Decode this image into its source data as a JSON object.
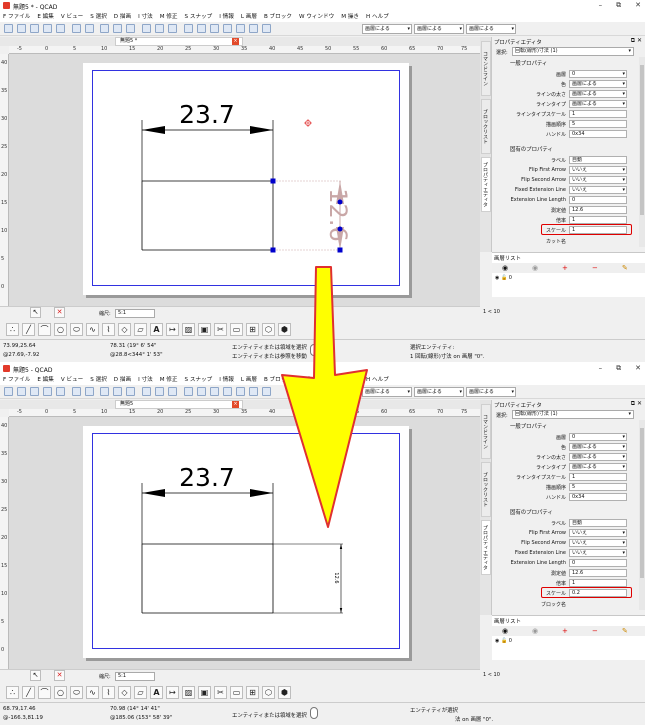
{
  "app": {
    "title_before": "無題5 * - QCAD",
    "title_after": "無題5 - QCAD",
    "window_buttons": [
      "–",
      "⧉",
      "✕"
    ]
  },
  "menu": [
    "F ファイル",
    "E 編集",
    "V ビュー",
    "S 選択",
    "D 描画",
    "I 寸法",
    "M 修正",
    "S スナップ",
    "I 情報",
    "L 画層",
    "B ブロック",
    "W ウィンドウ",
    "M 操き",
    "H ヘルプ"
  ],
  "toolbar": {
    "color_combo": "画層による",
    "width_combo": "画層による",
    "type_combo": "画層による"
  },
  "tab": {
    "before": "無題5 *",
    "after": "無題5"
  },
  "ruler": {
    "h_labels": [
      "-5",
      "0",
      "5",
      "10",
      "15",
      "20",
      "25",
      "30",
      "35",
      "40",
      "45",
      "50",
      "55",
      "60",
      "65",
      "70",
      "75",
      "80"
    ],
    "v_labels": [
      "40",
      "35",
      "30",
      "25",
      "20",
      "15",
      "10",
      "5",
      "0"
    ]
  },
  "drawing": {
    "top_dimension": "23.7",
    "side_dimension_before": "12.6",
    "side_dimension_after": "12.6"
  },
  "dock": {
    "side_tabs": [
      "コマンドライン",
      "ブロックリスト",
      "プロパティエディタ"
    ],
    "prop_title": "プロパティエディタ",
    "select_label": "選択:",
    "select_value": "回転(線形)寸法 (1)",
    "general_header": "一般プロパティ",
    "specific_header": "固有のプロパティ",
    "general": [
      {
        "label": "画層",
        "value": "0",
        "combo": true
      },
      {
        "label": "色",
        "value": "画層による",
        "combo": true
      },
      {
        "label": "ラインの太さ",
        "value": "画層による",
        "combo": true
      },
      {
        "label": "ラインタイプ",
        "value": "画層による",
        "combo": true
      },
      {
        "label": "ラインタイプスケール",
        "value": "1",
        "combo": false
      },
      {
        "label": "描画順序",
        "value": "5",
        "combo": false
      },
      {
        "label": "ハンドル",
        "value": "0x34",
        "combo": false
      }
    ],
    "specific": [
      {
        "label": "ラベル",
        "value": "自動",
        "combo": false
      },
      {
        "label": "Flip First Arrow",
        "value": "いいえ",
        "combo": true
      },
      {
        "label": "Flip Second Arrow",
        "value": "いいえ",
        "combo": true
      },
      {
        "label": "Fixed Extension Line",
        "value": "いいえ",
        "combo": true
      },
      {
        "label": "Extension Line Length",
        "value": "0",
        "combo": false
      },
      {
        "label": "測定値",
        "value": "12.6",
        "combo": false
      },
      {
        "label": "倍率",
        "value": "1",
        "combo": false
      }
    ],
    "scale_label": "スケール",
    "scale_before": "1",
    "scale_after": "0.2",
    "cut_label_before": "カット名",
    "cut_label_after": "ブロック名",
    "layer_title": "画層リスト",
    "layer_name": "0"
  },
  "snap": {
    "scale_label": "縮尺:",
    "scale_value": "5:1"
  },
  "page_count": "1 < 10",
  "status_before": {
    "coord1": "73.99,25.64",
    "coord2": "@27.69,-7.92",
    "polar1": "78.31 (19° 6' 54\"",
    "polar2": "@28.8<344° 1' 53\"",
    "hint1": "エンティティまたは領域を選択",
    "hint2": "エンティティまたは参照を移動",
    "sel1": "選択エンティティ:",
    "sel2": "1 回転(線形)寸法 on 画層 \"0\"."
  },
  "status_after": {
    "coord1": "68.79,17.46",
    "coord2": "@-166.3,81.19",
    "polar1": "70.98 (14° 14' 41\"",
    "polar2": "@185.06 (153° 58' 39\"",
    "hint1": "エンティティまたは領域を選択",
    "sel1": "エンティティが選択",
    "sel2": "法 on 画層 \"0\"."
  },
  "colors": {
    "page_border": "#3232e0",
    "highlight": "#e00000",
    "arrow_fill": "#ffff00",
    "arrow_stroke": "#e03030",
    "grip": "#0000cc",
    "ghost": "#c9a7a7"
  }
}
